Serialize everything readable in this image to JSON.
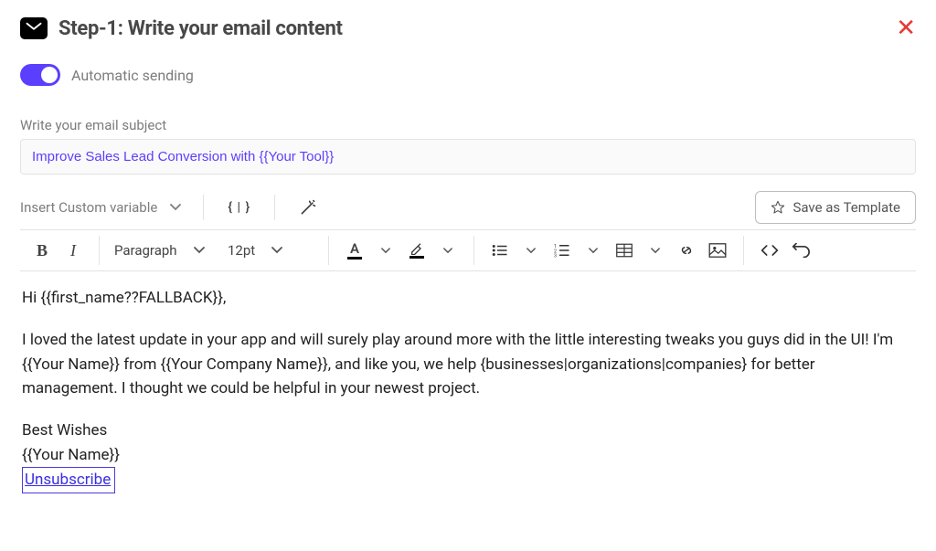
{
  "header": {
    "title": "Step-1:  Write your email content"
  },
  "toggle": {
    "label": "Automatic sending"
  },
  "subject": {
    "label": "Write your email subject",
    "value": "Improve Sales Lead Conversion with {{Your Tool}}"
  },
  "toolbar": {
    "custom_variable_label": "Insert Custom variable",
    "braces_label": "{ | }",
    "save_template_label": "Save as Template",
    "paragraph_label": "Paragraph",
    "fontsize_label": "12pt"
  },
  "body": {
    "line1": "Hi {{first_name??FALLBACK}},",
    "para": "I loved the latest update in your app and will surely play around more with the little interesting tweaks you guys did in the UI! I'm {{Your Name}} from {{Your Company Name}}, and like you, we help {businesses|organizations|companies} for better management. I thought we could be helpful in your newest project.",
    "closing1": "Best Wishes",
    "closing2": "{{Your Name}}",
    "unsubscribe": "Unsubscribe"
  }
}
